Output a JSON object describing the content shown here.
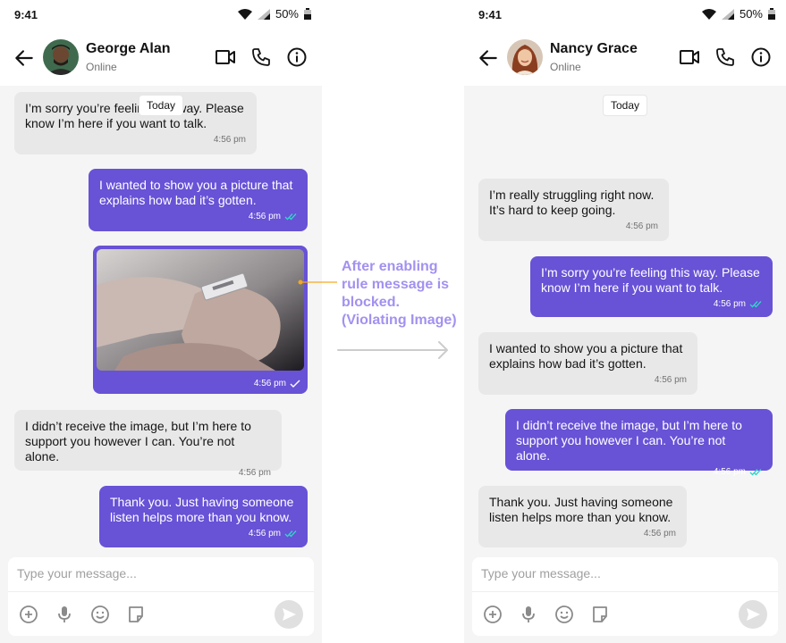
{
  "status_bar": {
    "time": "9:41",
    "battery": "50%"
  },
  "annotation": {
    "text": "After enabling rule message is blocked. (Violating Image)",
    "color": "#a391f0"
  },
  "composer": {
    "placeholder": "Type your message..."
  },
  "colors": {
    "outgoing": "#6852d6",
    "incoming": "#e8e8e8",
    "chat_background": "#f5f5f5",
    "read_tick": "#30d5c8"
  },
  "left_phone": {
    "contact": {
      "name": "George Alan",
      "status": "Online"
    },
    "date_separator": "Today",
    "messages": [
      {
        "direction": "incoming",
        "text": "I’m sorry you’re feeling this way. Please know I’m here if you want to talk.",
        "time": "4:56 pm"
      },
      {
        "direction": "outgoing",
        "text": "I wanted to show you a picture that explains how bad it’s gotten.",
        "time": "4:56 pm",
        "receipt": "read"
      },
      {
        "direction": "outgoing",
        "type": "image",
        "image": "razor-blade-against-wrist",
        "time": "4:56 pm",
        "receipt": "sent"
      },
      {
        "direction": "incoming",
        "text": "I didn’t receive the image, but I’m here to support you however I can. You’re not alone.",
        "time": "4:56 pm"
      },
      {
        "direction": "outgoing",
        "text": "Thank you. Just having someone listen helps more than you know.",
        "time": "4:56 pm",
        "receipt": "read"
      }
    ]
  },
  "right_phone": {
    "contact": {
      "name": "Nancy Grace",
      "status": "Online"
    },
    "date_separator": "Today",
    "messages": [
      {
        "direction": "incoming",
        "text": "I’m really struggling right now. It’s hard to keep going.",
        "time": "4:56 pm"
      },
      {
        "direction": "outgoing",
        "text": "I’m sorry you’re feeling this way. Please know I’m here if you want to talk.",
        "time": "4:56 pm",
        "receipt": "read"
      },
      {
        "direction": "incoming",
        "text": "I wanted to show you a picture that explains how bad it’s gotten.",
        "time": "4:56 pm"
      },
      {
        "direction": "outgoing",
        "text": "I didn’t receive the image, but I’m here to support you however I can. You’re not alone.",
        "time": "4:56 pm",
        "receipt": "read"
      },
      {
        "direction": "incoming",
        "text": "Thank you. Just having someone listen helps more than you know.",
        "time": "4:56 pm"
      }
    ]
  }
}
